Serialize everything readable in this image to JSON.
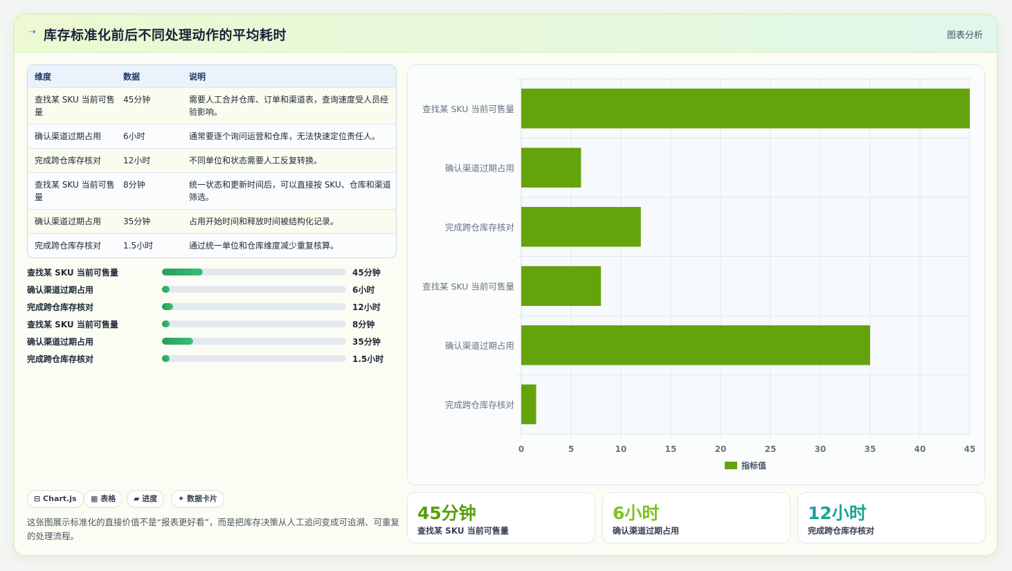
{
  "header": {
    "icon": "trend-icon",
    "title": "库存标准化前后不同处理动作的平均耗时",
    "right_label": "图表分析"
  },
  "table": {
    "columns": [
      "维度",
      "数据",
      "说明"
    ],
    "rows": [
      {
        "dim": "查找某 SKU 当前可售量",
        "value": "45分钟",
        "desc": "需要人工合并仓库、订单和渠道表，查询速度受人员经验影响。"
      },
      {
        "dim": "确认渠道过期占用",
        "value": "6小时",
        "desc": "通常要逐个询问运营和仓库，无法快速定位责任人。"
      },
      {
        "dim": "完成跨仓库存核对",
        "value": "12小时",
        "desc": "不同单位和状态需要人工反复转换。"
      },
      {
        "dim": "查找某 SKU 当前可售量",
        "value": "8分钟",
        "desc": "统一状态和更新时间后，可以直接按 SKU、仓库和渠道筛选。"
      },
      {
        "dim": "确认渠道过期占用",
        "value": "35分钟",
        "desc": "占用开始时间和释放时间被结构化记录。"
      },
      {
        "dim": "完成跨仓库存核对",
        "value": "1.5小时",
        "desc": "通过统一单位和仓库维度减少重复核算。"
      }
    ]
  },
  "progress": [
    {
      "label": "查找某 SKU 当前可售量",
      "value": "45分钟",
      "fraction": 0.22
    },
    {
      "label": "确认渠道过期占用",
      "value": "6小时",
      "fraction": 0.04
    },
    {
      "label": "完成跨仓库存核对",
      "value": "12小时",
      "fraction": 0.06
    },
    {
      "label": "查找某 SKU 当前可售量",
      "value": "8分钟",
      "fraction": 0.04
    },
    {
      "label": "确认渠道过期占用",
      "value": "35分钟",
      "fraction": 0.17
    },
    {
      "label": "完成跨仓库存核对",
      "value": "1.5小时",
      "fraction": 0.04
    }
  ],
  "chips": [
    {
      "icon": "chart-icon",
      "label": "⊟ Chart.js"
    },
    {
      "icon": "table-icon",
      "label": "▦ 表格"
    },
    {
      "icon": "progress-icon",
      "label": "▰ 进度"
    },
    {
      "icon": "card-icon",
      "label": "✦ 数据卡片"
    }
  ],
  "note": "这张图展示标准化的直接价值不是“报表更好看”，而是把库存决策从人工追问变成可追溯、可重复的处理流程。",
  "stats": [
    {
      "value": "45分钟",
      "label": "查找某 SKU 当前可售量",
      "color": "#5a9e0c"
    },
    {
      "value": "6小时",
      "label": "确认渠道过期占用",
      "color": "#7cc31f"
    },
    {
      "value": "12小时",
      "label": "完成跨仓库存核对",
      "color": "#19a598"
    }
  ],
  "colors": {
    "bar": "#65a30d",
    "accent": "#1e6fd9"
  },
  "chart_data": {
    "type": "bar",
    "orientation": "horizontal",
    "categories": [
      "查找某 SKU 当前可售量",
      "确认渠道过期占用",
      "完成跨仓库存核对",
      "查找某 SKU 当前可售量",
      "确认渠道过期占用",
      "完成跨仓库存核对"
    ],
    "series": [
      {
        "name": "指标值",
        "values": [
          45,
          6,
          12,
          8,
          35,
          1.5
        ]
      }
    ],
    "xlim": [
      0,
      45
    ],
    "xticks": [
      0,
      5,
      10,
      15,
      20,
      25,
      30,
      35,
      40,
      45
    ],
    "grid": true,
    "legend": "bottom"
  }
}
